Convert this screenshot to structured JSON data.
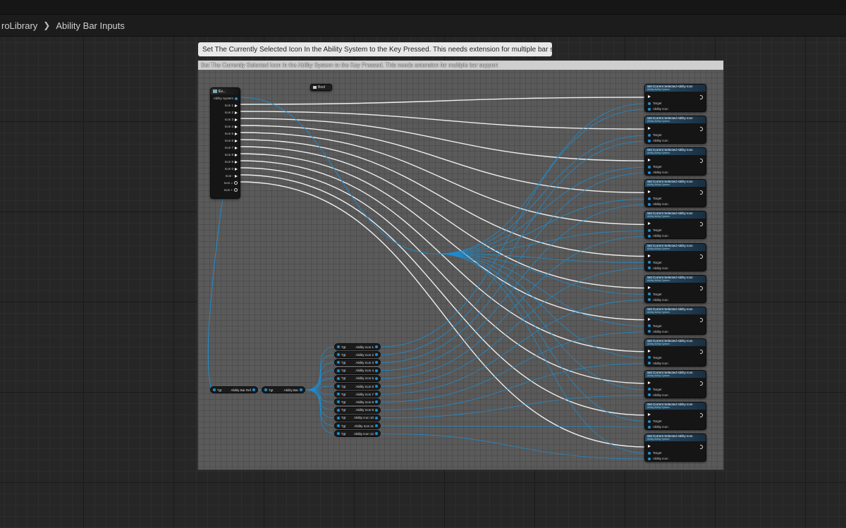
{
  "breadcrumb": {
    "parent": "roLibrary",
    "separator": "❯",
    "current": "Ability Bar Inputs"
  },
  "comment": {
    "tooltip": "Set The Currently Selected Icon In the Ability System to the Key Pressed. This needs extension for multiple bar support",
    "header": "Set The Currently Selected Icon In the Ability System to the Key Pressed. This needs extension for multiple bar support"
  },
  "event_node": {
    "title": "Ev...",
    "ability_system_pin": "Ability System",
    "key_pins": [
      "Icon 1",
      "Icon 2",
      "Icon 3",
      "Icon 4",
      "Icon 5",
      "Icon 6",
      "Icon 7",
      "Icon 8",
      "Icon 9",
      "Icon 0",
      "Icon -",
      "Icon ="
    ],
    "extra_pins": [
      "Icon +"
    ]
  },
  "small_node": {
    "label": "Bool"
  },
  "variable_nodes": {
    "ability_bar_ref": "Ability Bar Ref",
    "ability_bar": "Ability Bar",
    "getter_labels": [
      "Ability Icon 1",
      "Ability Icon 2",
      "Ability Icon 3",
      "Ability Icon 4",
      "Ability Icon 5",
      "Ability Icon 6",
      "Ability Icon 7",
      "Ability Icon 8",
      "Ability Icon 9",
      "Ability Icon 10",
      "Ability Icon 11",
      "Ability Icon 12"
    ],
    "target_prefix": "Tgt"
  },
  "set_nodes": {
    "title": "Set Current Selected Ability Icon",
    "subtitle": "Ability Ability System",
    "target_label": "Target",
    "icon_label": "Ability Icon",
    "count": 12
  },
  "colors": {
    "exec_wire": "#ffffff",
    "object_wire": "#1a8fd6",
    "node_header": "#28506e",
    "comment_bg": "#6b6b6b"
  }
}
